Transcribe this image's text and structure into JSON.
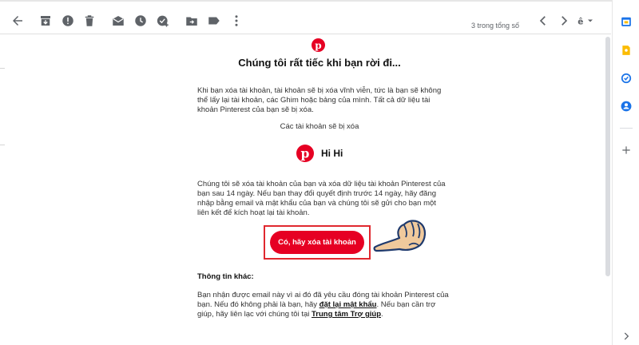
{
  "toolbar": {
    "icons": [
      "back-arrow-icon",
      "archive-icon",
      "report-spam-icon",
      "delete-icon",
      "mark-unread-icon",
      "snooze-icon",
      "add-to-tasks-icon",
      "move-to-icon",
      "label-icon",
      "more-icon"
    ],
    "count_text": "3 trong tổng số",
    "nav": [
      "older-chevron-icon",
      "newer-chevron-icon"
    ],
    "input_tools": "input-tools-icon"
  },
  "right_rail": {
    "icons": [
      "calendar-icon",
      "keep-icon",
      "tasks-icon",
      "contacts-icon",
      "add-icon",
      "expand-chevron-icon"
    ],
    "colors": {
      "calendar": "#1a73e8",
      "keep": "#fbbc04",
      "tasks": "#1a73e8",
      "contacts": "#1a73e8"
    }
  },
  "email": {
    "brand_color": "#e60023",
    "heading": "Chúng tôi rất tiếc khi bạn rời đi...",
    "para1": "Khi bạn xóa tài khoản, tài khoản sẽ bị xóa vĩnh viễn, tức là bạn sẽ không thể lấy lại tài khoản, các Ghim hoặc bảng của mình. Tất cả dữ liệu tài khoản Pinterest của bạn sẽ bị xóa.",
    "deleted_label": "Các tài khoản sẽ bị xóa",
    "profile_name": "Hi Hi",
    "para2": "Chúng tôi sẽ xóa tài khoản của bạn và xóa dữ liệu tài khoản Pinterest của bạn sau 14 ngày. Nếu bạn thay đổi quyết định trước 14 ngày, hãy đăng nhập bằng email và mật khẩu của bạn và chúng tôi sẽ gửi cho bạn một liên kết để kích hoạt lại tài khoản.",
    "confirm_button": "Có, hãy xóa tài khoản",
    "other_info_title": "Thông tin khác:",
    "para3_a": "Bạn nhận được email này vì ai đó đã yêu cầu đóng tài khoản Pinterest của bạn. Nếu đó không phải là bạn, hãy ",
    "reset_link": "đặt lại mật khẩu",
    "para3_b": ". Nếu bạn cần trợ giúp, hãy liên lạc với chúng tôi tại ",
    "help_link": "Trung tâm Trợ giúp",
    "para3_c": "."
  }
}
